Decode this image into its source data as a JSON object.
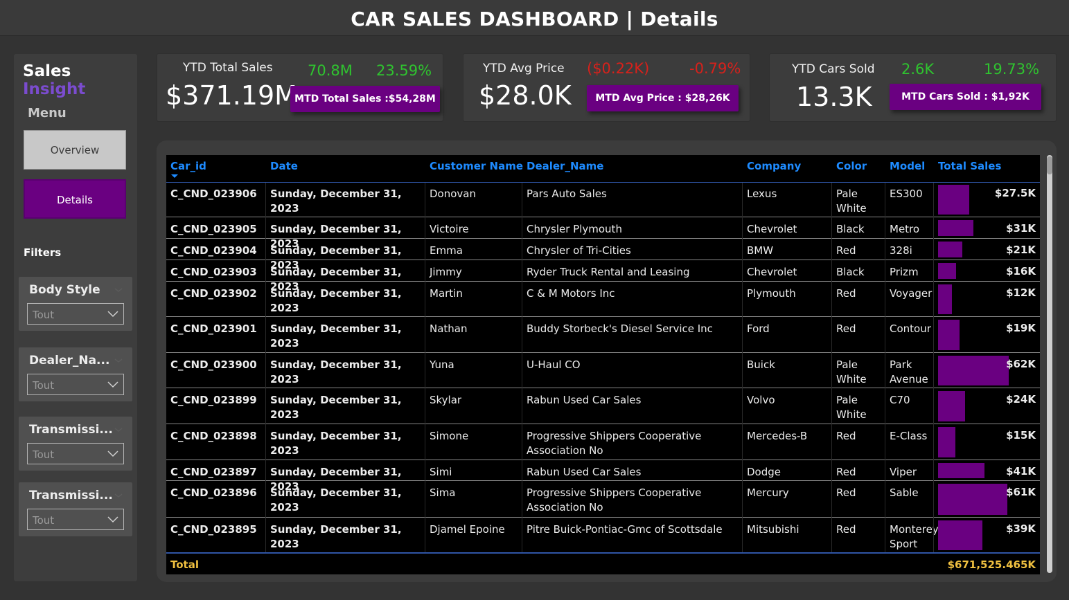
{
  "title": "CAR SALES DASHBOARD | Details",
  "sidebar": {
    "brand_part1": "Sales",
    "brand_part2": "Insight",
    "menu_label": "Menu",
    "nav": [
      {
        "label": "Overview",
        "active": false
      },
      {
        "label": "Details",
        "active": true
      }
    ],
    "filters_label": "Filters",
    "slicers": [
      {
        "title": "Body Style",
        "value": "Tout"
      },
      {
        "title": "Dealer_Na...",
        "value": "Tout"
      },
      {
        "title": "Transmissi...",
        "value": "Tout"
      },
      {
        "title": "Transmissi...",
        "value": "Tout"
      }
    ]
  },
  "kpis": [
    {
      "label": "YTD Total Sales",
      "value": "$371.19M",
      "delta1": "70.8M",
      "delta2": "23.59%",
      "trend": "up",
      "mtd": "MTD Total Sales :$54,28M"
    },
    {
      "label": "YTD Avg Price",
      "value": "$28.0K",
      "delta1": "($0.22K)",
      "delta2": "-0.79%",
      "trend": "down",
      "mtd": "MTD Avg Price : $28,26K"
    },
    {
      "label": "YTD Cars Sold",
      "value": "13.3K",
      "delta1": "2.6K",
      "delta2": "19.73%",
      "trend": "up",
      "mtd": "MTD Cars Sold : $1,92K"
    }
  ],
  "table": {
    "columns": [
      "Car_id",
      "Date",
      "Customer Name",
      "Dealer_Name",
      "Company",
      "Color",
      "Model",
      "Total Sales"
    ],
    "sorted_column": "Car_id",
    "sort_direction": "descending",
    "bar_color": "#6a0081",
    "rows": [
      {
        "car_id": "C_CND_023906",
        "date": "Sunday, December 31, 2023",
        "customer": "Donovan",
        "dealer": "Pars Auto Sales",
        "company": "Lexus",
        "color": "Pale White",
        "model": "ES300",
        "sales": "$27.5K",
        "sales_value": 27.5
      },
      {
        "car_id": "C_CND_023905",
        "date": "Sunday, December 31, 2023",
        "customer": "Victoire",
        "dealer": "Chrysler Plymouth",
        "company": "Chevrolet",
        "color": "Black",
        "model": "Metro",
        "sales": "$31K",
        "sales_value": 31
      },
      {
        "car_id": "C_CND_023904",
        "date": "Sunday, December 31, 2023",
        "customer": "Emma",
        "dealer": "Chrysler of Tri-Cities",
        "company": "BMW",
        "color": "Red",
        "model": "328i",
        "sales": "$21K",
        "sales_value": 21
      },
      {
        "car_id": "C_CND_023903",
        "date": "Sunday, December 31, 2023",
        "customer": "Jimmy",
        "dealer": "Ryder Truck Rental and Leasing",
        "company": "Chevrolet",
        "color": "Black",
        "model": "Prizm",
        "sales": "$16K",
        "sales_value": 16
      },
      {
        "car_id": "C_CND_023902",
        "date": "Sunday, December 31, 2023",
        "customer": "Martin",
        "dealer": "C & M Motors Inc",
        "company": "Plymouth",
        "color": "Red",
        "model": "Voyager",
        "sales": "$12K",
        "sales_value": 12
      },
      {
        "car_id": "C_CND_023901",
        "date": "Sunday, December 31, 2023",
        "customer": "Nathan",
        "dealer": "Buddy Storbeck's Diesel Service Inc",
        "company": "Ford",
        "color": "Red",
        "model": "Contour",
        "sales": "$19K",
        "sales_value": 19
      },
      {
        "car_id": "C_CND_023900",
        "date": "Sunday, December 31, 2023",
        "customer": "Yuna",
        "dealer": "U-Haul CO",
        "company": "Buick",
        "color": "Pale White",
        "model": "Park Avenue",
        "sales": "$62K",
        "sales_value": 62
      },
      {
        "car_id": "C_CND_023899",
        "date": "Sunday, December 31, 2023",
        "customer": "Skylar",
        "dealer": "Rabun Used Car Sales",
        "company": "Volvo",
        "color": "Pale White",
        "model": "C70",
        "sales": "$24K",
        "sales_value": 24
      },
      {
        "car_id": "C_CND_023898",
        "date": "Sunday, December 31, 2023",
        "customer": "Simone",
        "dealer": "Progressive Shippers Cooperative Association No",
        "company": "Mercedes-B",
        "color": "Red",
        "model": "E-Class",
        "sales": "$15K",
        "sales_value": 15
      },
      {
        "car_id": "C_CND_023897",
        "date": "Sunday, December 31, 2023",
        "customer": "Simi",
        "dealer": "Rabun Used Car Sales",
        "company": "Dodge",
        "color": "Red",
        "model": "Viper",
        "sales": "$41K",
        "sales_value": 41
      },
      {
        "car_id": "C_CND_023896",
        "date": "Sunday, December 31, 2023",
        "customer": "Sima",
        "dealer": "Progressive Shippers Cooperative Association No",
        "company": "Mercury",
        "color": "Red",
        "model": "Sable",
        "sales": "$61K",
        "sales_value": 61
      },
      {
        "car_id": "C_CND_023895",
        "date": "Sunday, December 31, 2023",
        "customer": "Djamel Epoine",
        "dealer": "Pitre Buick-Pontiac-Gmc of Scottsdale",
        "company": "Mitsubishi",
        "color": "Red",
        "model": "Monterey Sport",
        "sales": "$39K",
        "sales_value": 39
      }
    ],
    "total_label": "Total",
    "total_value": "$671,525.465K"
  }
}
